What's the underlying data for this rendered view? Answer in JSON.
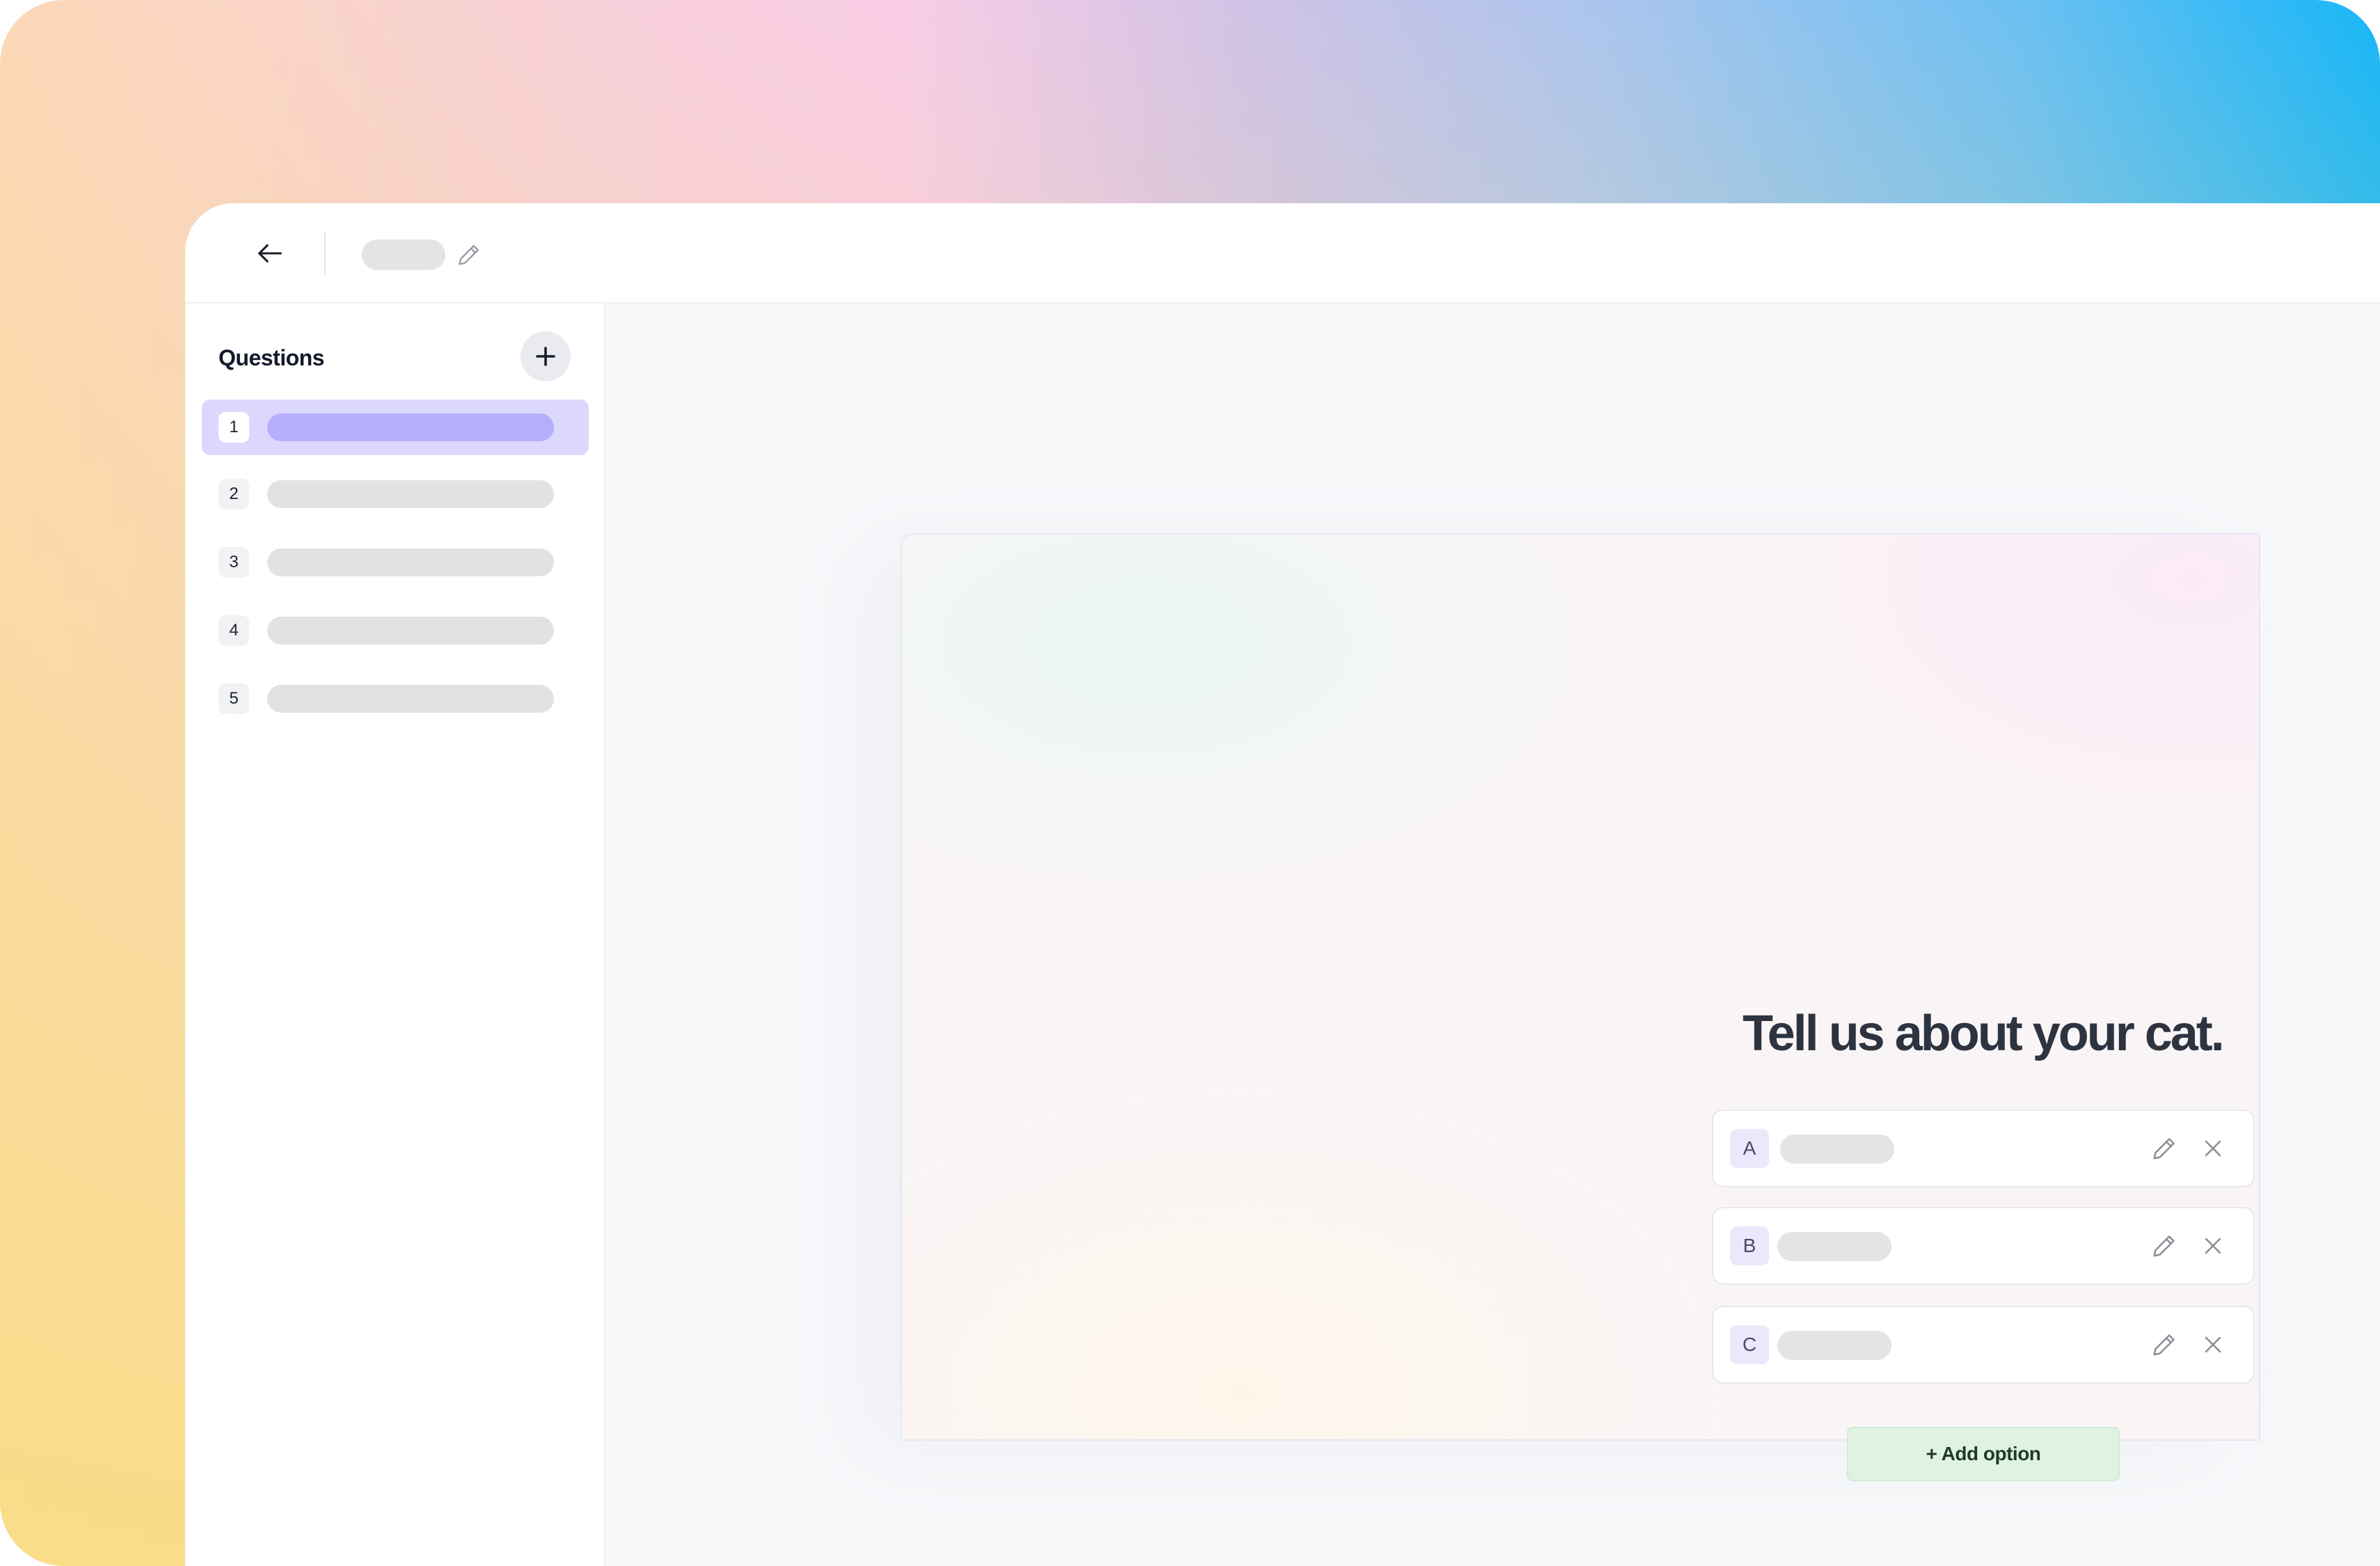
{
  "sidebar": {
    "title": "Questions",
    "add_icon": "plus-icon",
    "items": [
      {
        "number": "1",
        "active": true
      },
      {
        "number": "2",
        "active": false
      },
      {
        "number": "3",
        "active": false
      },
      {
        "number": "4",
        "active": false
      },
      {
        "number": "5",
        "active": false
      }
    ]
  },
  "topbar": {
    "back_icon": "arrow-left-icon",
    "edit_icon": "pencil-icon"
  },
  "question": {
    "title": "Tell us about your cat.",
    "options": [
      {
        "letter": "A"
      },
      {
        "letter": "B"
      },
      {
        "letter": "C"
      }
    ],
    "add_option_label": "+ Add option"
  },
  "colors": {
    "accent": "#b6aefb",
    "accent_light": "#dcd8fd",
    "add_option_bg": "#e0f2e2",
    "text_dark": "#2e3340"
  }
}
